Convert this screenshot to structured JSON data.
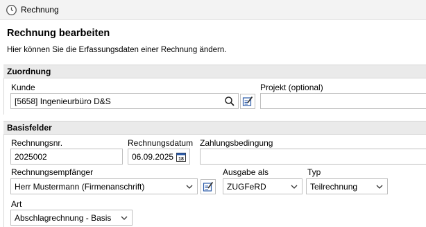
{
  "window": {
    "title": "Rechnung"
  },
  "header": {
    "title": "Rechnung bearbeiten",
    "subtitle": "Hier können Sie die Erfassungsdaten einer Rechnung ändern."
  },
  "zuordnung": {
    "section_title": "Zuordnung",
    "kunde": {
      "label": "Kunde",
      "value": "[5658] Ingenieurbüro D&S"
    },
    "projekt": {
      "label": "Projekt (optional)",
      "value": ""
    }
  },
  "basisfelder": {
    "section_title": "Basisfelder",
    "rechnungsnr": {
      "label": "Rechnungsnr.",
      "value": "2025002"
    },
    "rechnungsdatum": {
      "label": "Rechnungsdatum",
      "value": "06.09.2025",
      "calendar_icon_text": "18"
    },
    "zahlungsbedingung": {
      "label": "Zahlungsbedingung",
      "value": ""
    },
    "empfaenger": {
      "label": "Rechnungsempfänger",
      "value": "Herr Mustermann (Firmenanschrift)"
    },
    "ausgabe": {
      "label": "Ausgabe als",
      "value": "ZUGFeRD"
    },
    "typ": {
      "label": "Typ",
      "value": "Teilrechnung"
    },
    "art": {
      "label": "Art",
      "value": "Abschlagrechnung - Basis"
    }
  },
  "icons": {
    "app": "clock-icon",
    "search": "search-icon",
    "edit": "edit-icon",
    "calendar": "calendar-icon",
    "dropdown": "chevron-down-icon"
  },
  "colors": {
    "accent": "#2a5aa8",
    "section_bg": "#eaeaea",
    "border": "#bfbfbf"
  }
}
